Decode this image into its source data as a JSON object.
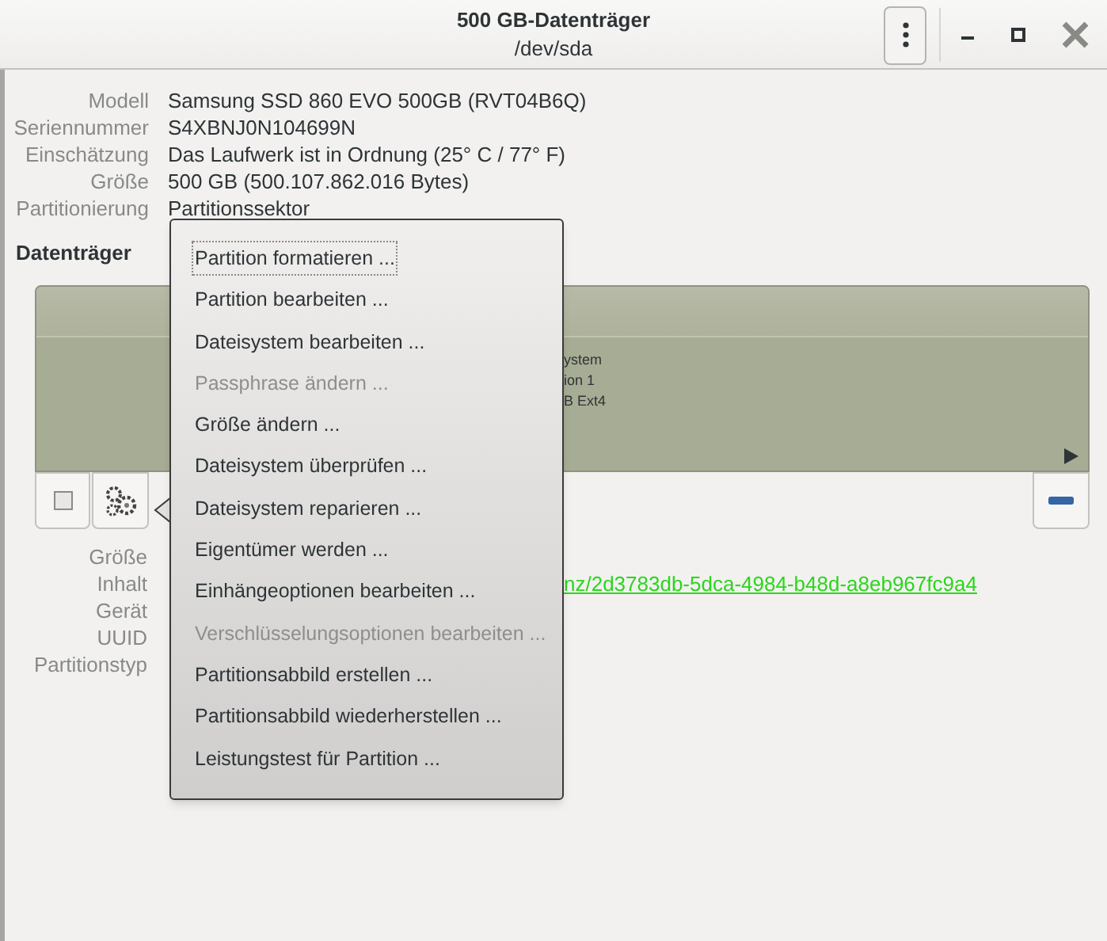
{
  "window": {
    "title": "500 GB-Datenträger",
    "subtitle": "/dev/sda"
  },
  "drive_info": [
    {
      "label": "Modell",
      "value": "Samsung SSD 860 EVO 500GB (RVT04B6Q)"
    },
    {
      "label": "Seriennummer",
      "value": "S4XBNJ0N104699N"
    },
    {
      "label": "Einschätzung",
      "value": "Das Laufwerk ist in Ordnung (25° C / 77° F)"
    },
    {
      "label": "Größe",
      "value": "500 GB (500.107.862.016 Bytes)"
    },
    {
      "label": "Partitionierung",
      "value": "Partitionssektor"
    }
  ],
  "volumes": {
    "heading": "Datenträger",
    "partition_text": [
      "ystem",
      "ion 1",
      "B Ext4"
    ]
  },
  "partition_info": [
    {
      "label": "Größe"
    },
    {
      "label": "Inhalt",
      "link": "nz/2d3783db-5dca-4984-b48d-a8eb967fc9a4"
    },
    {
      "label": "Gerät"
    },
    {
      "label": "UUID"
    },
    {
      "label": "Partitionstyp"
    }
  ],
  "menu": [
    {
      "label": "Partition formatieren ...",
      "disabled": false,
      "focused": true
    },
    {
      "label": "Partition bearbeiten ...",
      "disabled": false,
      "focused": false
    },
    {
      "label": "Dateisystem bearbeiten ...",
      "disabled": false,
      "focused": false
    },
    {
      "label": "Passphrase ändern ...",
      "disabled": true,
      "focused": false
    },
    {
      "label": "Größe ändern ...",
      "disabled": false,
      "focused": false
    },
    {
      "label": "Dateisystem überprüfen ...",
      "disabled": false,
      "focused": false
    },
    {
      "label": "Dateisystem reparieren ...",
      "disabled": false,
      "focused": false
    },
    {
      "label": "Eigentümer werden ...",
      "disabled": false,
      "focused": false
    },
    {
      "label": "Einhängeoptionen bearbeiten ...",
      "disabled": false,
      "focused": false
    },
    {
      "label": "Verschlüsselungsoptionen bearbeiten ...",
      "disabled": true,
      "focused": false
    },
    {
      "label": "Partitionsabbild erstellen ...",
      "disabled": false,
      "focused": false
    },
    {
      "label": "Partitionsabbild wiederherstellen ...",
      "disabled": false,
      "focused": false
    },
    {
      "label": "Leistungstest für Partition ...",
      "disabled": false,
      "focused": false
    }
  ]
}
